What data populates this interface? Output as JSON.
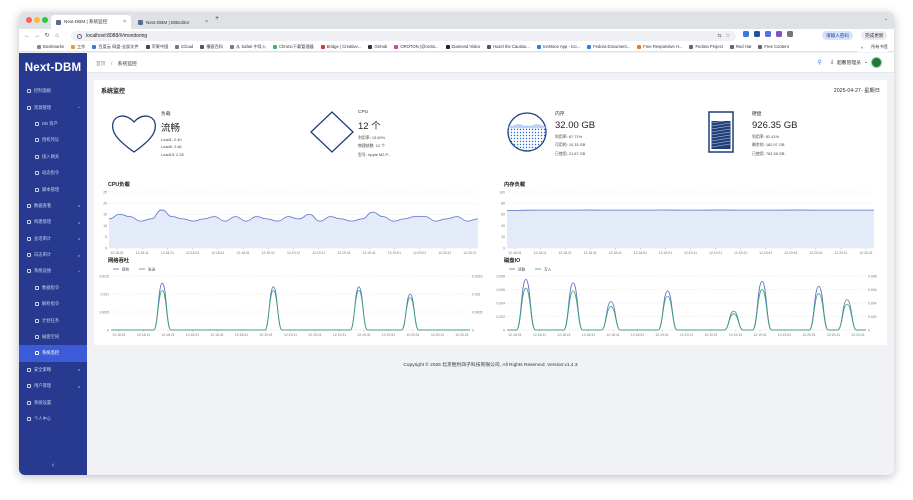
{
  "browser": {
    "tabs": [
      {
        "title": "Next-DBM | 系统监控",
        "active": true
      },
      {
        "title": "Next-DBM | DBEditor",
        "active": false
      }
    ],
    "new_tab": "+",
    "url": "localhost:8088/#/monitoring",
    "translate_pill": "请输入密码",
    "update_pill": "完成更新",
    "bookmarks": [
      "Bookmarks",
      "工作",
      "百度云 网盘-全部文件",
      "苹果中国",
      "iCloud",
      "播客百科",
      "从 Safari 中导入",
      "Chrono下载管理器",
      "Bridge | Creative...",
      "GitHub",
      "OROTON (@oroto...",
      "Diamond Video",
      "Hazel the Cautiou...",
      "IceMoon App - Ico...",
      "Fedora Document...",
      "Free Responsive H...",
      "Fedora Project",
      "Red Hat",
      "Free Content"
    ],
    "bookmarks_more": "»",
    "all_bookmarks": "所有书签"
  },
  "sidebar": {
    "logo": "Next-DBM",
    "items": [
      {
        "label": "控制面板",
        "sub": false,
        "active": false,
        "chevron": ""
      },
      {
        "label": "资源管理",
        "sub": false,
        "active": false,
        "chevron": "^"
      },
      {
        "label": "DB 资产",
        "sub": true,
        "active": false,
        "chevron": ""
      },
      {
        "label": "授权凭证",
        "sub": true,
        "active": false,
        "chevron": ""
      },
      {
        "label": "接入网关",
        "sub": true,
        "active": false,
        "chevron": ""
      },
      {
        "label": "动态指令",
        "sub": true,
        "active": false,
        "chevron": ""
      },
      {
        "label": "脚本管理",
        "sub": true,
        "active": false,
        "chevron": ""
      },
      {
        "label": "数据查看",
        "sub": false,
        "active": false,
        "chevron": "v"
      },
      {
        "label": "构建管理",
        "sub": false,
        "active": false,
        "chevron": "v"
      },
      {
        "label": "会话审计",
        "sub": false,
        "active": false,
        "chevron": "v"
      },
      {
        "label": "日志审计",
        "sub": false,
        "active": false,
        "chevron": "v"
      },
      {
        "label": "系统运维",
        "sub": false,
        "active": false,
        "chevron": "^"
      },
      {
        "label": "数据指令",
        "sub": true,
        "active": false,
        "chevron": ""
      },
      {
        "label": "解析指令",
        "sub": true,
        "active": false,
        "chevron": ""
      },
      {
        "label": "计划任务",
        "sub": true,
        "active": false,
        "chevron": ""
      },
      {
        "label": "磁盘空间",
        "sub": true,
        "active": false,
        "chevron": ""
      },
      {
        "label": "系统监控",
        "sub": true,
        "active": true,
        "chevron": ""
      },
      {
        "label": "安全策略",
        "sub": false,
        "active": false,
        "chevron": "v"
      },
      {
        "label": "用户管理",
        "sub": false,
        "active": false,
        "chevron": "v"
      },
      {
        "label": "系统设置",
        "sub": false,
        "active": false,
        "chevron": ""
      },
      {
        "label": "个人中心",
        "sub": false,
        "active": false,
        "chevron": ""
      }
    ],
    "collapse_glyph": "‹"
  },
  "header": {
    "breadcrumb": [
      "首页",
      "系统监控"
    ],
    "breadcrumb_sep": "/",
    "user_name": "超级管理员"
  },
  "card": {
    "title": "系统监控",
    "date": "2025-04-27- 星期日"
  },
  "stats": {
    "load": {
      "name": "负载",
      "value": "流畅",
      "lines": [
        "Load1: 2.40",
        "Load5: 2.46",
        "Load15: 2.26"
      ]
    },
    "cpu": {
      "name": "CPU",
      "value": "12 个",
      "lines": [
        "利用率: 13.62%",
        "物理核数: 12 个",
        "型号: Apple M2 P..."
      ]
    },
    "memory": {
      "name": "内存",
      "value": "32.00 GB",
      "usage_fraction": 0.677,
      "lines": [
        "利用率: 67.71%",
        "可用的: 10.33 GB",
        "已使用: 21.67 GB"
      ]
    },
    "disk": {
      "name": "硬盘",
      "value": "926.35 GB",
      "usage_fraction": 0.824,
      "lines": [
        "利用率: 82.41%",
        "剩余的: 162.97 GB",
        "已使用: 763.38 GB"
      ]
    }
  },
  "colors": {
    "sidebar_bg": "#283a8f",
    "sidebar_active": "#3d5bd6",
    "chart_blue": "#5470c6",
    "chart_green": "#3ba272",
    "gauge_stroke": "#1f3f7a"
  },
  "chart_data": [
    {
      "type": "area",
      "title": "CPU负载",
      "x": [
        "12:18:01",
        "12:18:11",
        "12:18:21",
        "12:18:31",
        "12:18:41",
        "12:18:51",
        "12:19:01",
        "12:19:11",
        "12:19:21",
        "12:19:31",
        "12:19:41",
        "12:19:51",
        "12:20:01",
        "12:20:11",
        "12:20:21"
      ],
      "ylim": [
        0,
        25
      ],
      "yticks": [
        "25",
        "20",
        "15",
        "10",
        "5",
        "0"
      ],
      "series": [
        {
          "values": [
            13,
            15,
            14,
            12,
            13,
            17,
            14,
            13,
            12,
            13,
            14,
            12,
            14,
            12,
            14,
            13,
            12,
            14,
            13,
            15,
            12,
            14,
            13,
            12,
            13,
            16,
            14,
            12,
            13,
            14,
            14,
            12,
            13,
            14,
            12,
            13
          ]
        }
      ]
    },
    {
      "type": "area",
      "title": "内存负载",
      "x": [
        "12:18:01",
        "12:18:11",
        "12:18:21",
        "12:18:31",
        "12:18:41",
        "12:18:51",
        "12:19:01",
        "12:19:11",
        "12:19:21",
        "12:19:31",
        "12:19:41",
        "12:19:51",
        "12:20:01",
        "12:20:11",
        "12:20:21"
      ],
      "ylim": [
        0,
        100
      ],
      "yticks": [
        "100",
        "80",
        "60",
        "40",
        "20",
        "0"
      ],
      "series": [
        {
          "values": [
            67,
            67.5,
            67.7,
            67.6,
            67.8,
            67.7,
            67.7,
            67.6,
            67.8,
            67.7,
            67.7,
            67.8,
            67.7,
            67.6,
            67.7,
            67.8,
            67.7,
            67.7,
            67.6,
            67.7
          ]
        }
      ]
    },
    {
      "type": "line",
      "title": "网络吞吐",
      "x": [
        "12:18:01",
        "12:18:11",
        "12:18:21",
        "12:18:31",
        "12:18:41",
        "12:18:51",
        "12:19:01",
        "12:19:11",
        "12:19:21",
        "12:19:31",
        "12:19:41",
        "12:19:51",
        "12:20:01",
        "12:20:11",
        "12:20:21"
      ],
      "ylim": [
        0,
        0.0015
      ],
      "yticks_left": [
        "0.0015",
        "0.001",
        "0.0005",
        "0"
      ],
      "yticks_right": [
        "0.0015",
        "0.001",
        "0.0005",
        "0"
      ],
      "series": [
        {
          "name": "接收",
          "values": [
            0,
            0,
            0,
            0,
            0,
            0,
            0.0013,
            0,
            0,
            0,
            0,
            0,
            0,
            0,
            0,
            0,
            0,
            0,
            0,
            0.0012,
            0,
            0,
            0,
            0,
            0,
            0,
            0,
            0,
            0,
            0.0012,
            0,
            0,
            0,
            0,
            0,
            0.001,
            0,
            0,
            0,
            0,
            0,
            0,
            0
          ]
        },
        {
          "name": "发送",
          "values": [
            0,
            0,
            0,
            0,
            0,
            0,
            0.0011,
            0,
            0,
            0,
            0,
            0,
            0,
            0,
            0,
            0,
            0,
            0,
            0,
            0.0011,
            0,
            0,
            0,
            0,
            0,
            0,
            0,
            0,
            0,
            0.0011,
            0,
            0,
            0,
            0,
            0,
            0.0009,
            0,
            0,
            0,
            0,
            0,
            0,
            0
          ]
        }
      ]
    },
    {
      "type": "line",
      "title": "磁盘IO",
      "x": [
        "12:18:01",
        "12:18:11",
        "12:18:21",
        "12:18:31",
        "12:18:41",
        "12:18:51",
        "12:19:01",
        "12:19:11",
        "12:19:21",
        "12:19:31",
        "12:19:41",
        "12:19:51",
        "12:20:01",
        "12:20:11",
        "12:20:21"
      ],
      "ylim": [
        0,
        0.008
      ],
      "yticks_left": [
        "0.008",
        "0.006",
        "0.004",
        "0.002",
        "0"
      ],
      "yticks_right": [
        "0.008",
        "0.006",
        "0.004",
        "0.002",
        "0"
      ],
      "series": [
        {
          "name": "读取",
          "values": [
            0,
            0,
            0.0075,
            0,
            0,
            0,
            0,
            0.007,
            0,
            0,
            0,
            0.0042,
            0,
            0,
            0,
            0,
            0,
            0.0058,
            0,
            0,
            0,
            0,
            0,
            0,
            0.0028,
            0,
            0,
            0.0072,
            0,
            0,
            0,
            0,
            0,
            0.0065,
            0,
            0,
            0.0045,
            0,
            0
          ]
        },
        {
          "name": "写入",
          "values": [
            0,
            0,
            0.0062,
            0,
            0,
            0,
            0,
            0.0058,
            0,
            0,
            0,
            0.0035,
            0,
            0,
            0,
            0,
            0,
            0.005,
            0,
            0,
            0,
            0,
            0,
            0,
            0.0024,
            0,
            0,
            0.006,
            0,
            0,
            0,
            0,
            0,
            0.0054,
            0,
            0,
            0.0038,
            0,
            0
          ]
        }
      ]
    }
  ],
  "footer": "Copyright © 2025 北京胜利四子科技有限公司, All Rights Reserved. Version:v1.4.3"
}
